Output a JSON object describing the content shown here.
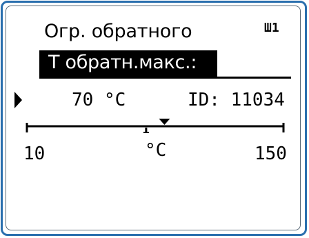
{
  "screen": {
    "title": "Огр. обратного",
    "heater_label": "Ш1",
    "parameter": {
      "name": "T обратн.макс.:",
      "value": "70 °C",
      "id": "ID: 11034"
    },
    "scale": {
      "min_label": "10",
      "unit_label": "°C",
      "max_label": "150",
      "min": 10,
      "max": 150,
      "setpoint": 70,
      "current": 60
    }
  },
  "colors": {
    "frame_border": "#2a6fae",
    "lcd_text": "#000000",
    "lcd_background": "#ffffff"
  }
}
